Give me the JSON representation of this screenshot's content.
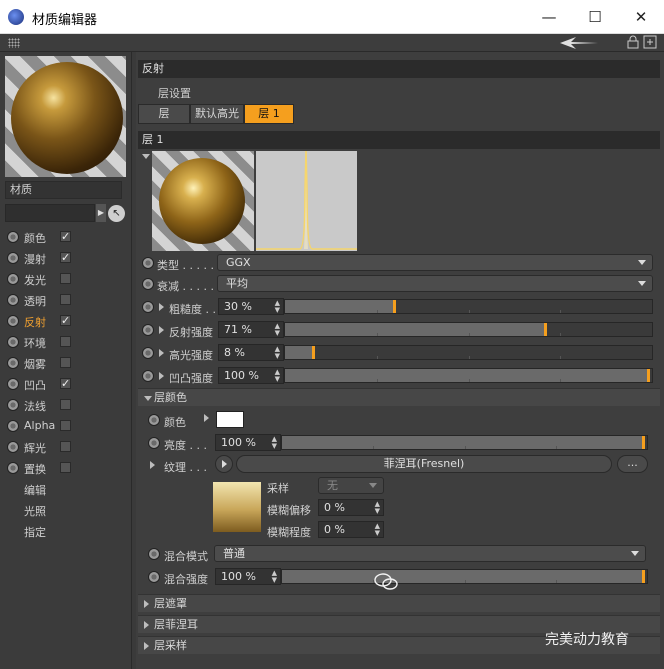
{
  "window": {
    "title": "材质编辑器",
    "minimize": "—",
    "maximize": "☐",
    "close": "✕"
  },
  "left": {
    "material_label": "材质",
    "channels": [
      {
        "label": "颜色",
        "checked": true
      },
      {
        "label": "漫射",
        "checked": true
      },
      {
        "label": "发光",
        "checked": false
      },
      {
        "label": "透明",
        "checked": false
      },
      {
        "label": "反射",
        "checked": true,
        "active": true
      },
      {
        "label": "环境",
        "checked": false
      },
      {
        "label": "烟雾",
        "checked": false
      },
      {
        "label": "凹凸",
        "checked": true
      },
      {
        "label": "法线",
        "checked": false
      },
      {
        "label": "Alpha",
        "checked": false
      },
      {
        "label": "辉光",
        "checked": false
      },
      {
        "label": "置换",
        "checked": false
      }
    ],
    "extras": [
      "编辑",
      "光照",
      "指定"
    ]
  },
  "right": {
    "section_title": "反射",
    "layer_settings_label": "层设置",
    "tabs": [
      "层",
      "默认高光",
      "层 1"
    ],
    "active_tab": 2,
    "layer_title": "层 1",
    "type_label": "类型 . . . . .",
    "type_value": "GGX",
    "attenuation_label": "衰减 . . . . .",
    "attenuation_value": "平均",
    "roughness_label": "粗糙度 . .",
    "roughness_value": "30 %",
    "roughness_fraction": 0.3,
    "reflect_strength_label": "反射强度",
    "reflect_strength_value": "71 %",
    "reflect_strength_fraction": 0.71,
    "specular_label": "高光强度",
    "specular_value": "8 %",
    "specular_fraction": 0.08,
    "bump_label": "凹凸强度",
    "bump_value": "100 %",
    "bump_fraction": 1.0,
    "layer_color_section": "层颜色",
    "color_label": "颜色",
    "brightness_label": "亮度 . . .",
    "brightness_value": "100 %",
    "brightness_fraction": 1.0,
    "texture_label": "纹理 . . .",
    "texture_button": "菲涅耳(Fresnel)",
    "texture_more": "...",
    "sampling_label": "采样",
    "sampling_value": "无",
    "blur_offset_label": "模糊偏移",
    "blur_offset_value": "0 %",
    "blur_degree_label": "模糊程度",
    "blur_degree_value": "0 %",
    "blend_mode_label": "混合模式",
    "blend_mode_value": "普通",
    "blend_strength_label": "混合强度",
    "blend_strength_value": "100 %",
    "blend_strength_fraction": 1.0,
    "collapsed_sections": [
      "层遮罩",
      "层菲涅耳",
      "层采样"
    ]
  },
  "watermark": "完美动力教育"
}
